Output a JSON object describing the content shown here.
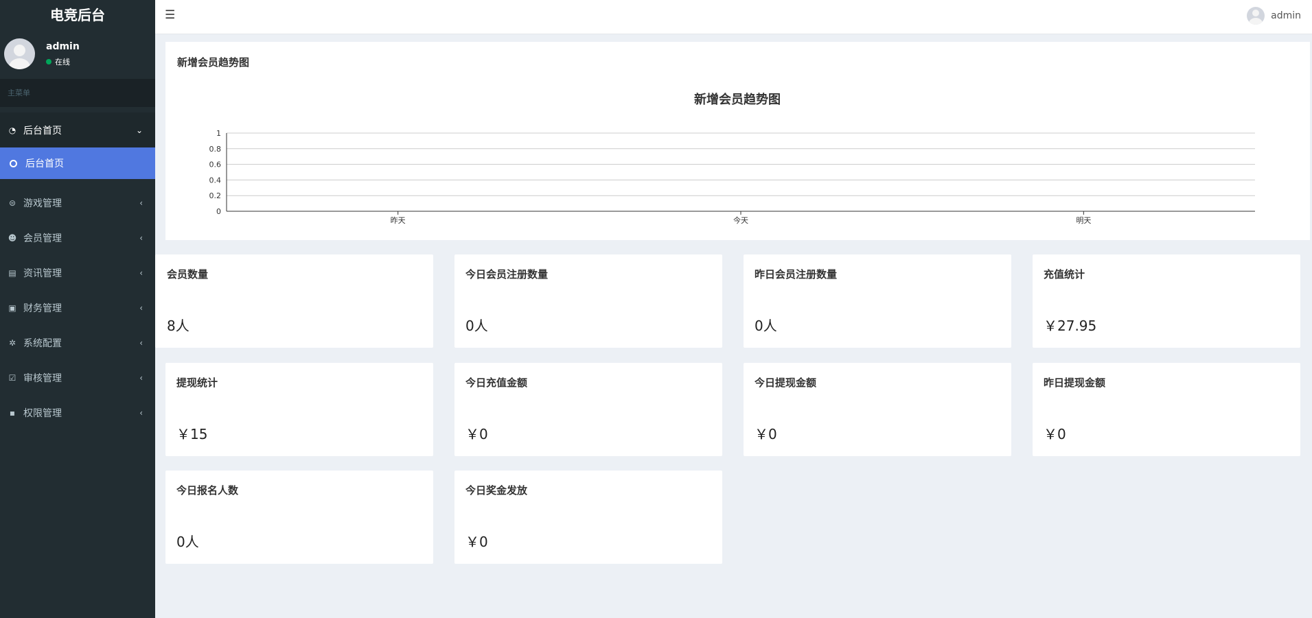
{
  "brand": "电竞后台",
  "user": {
    "name": "admin",
    "status": "在线"
  },
  "menu_header": "主菜单",
  "nav": {
    "home_parent": "后台首页",
    "home_sub": "后台首页",
    "items": [
      {
        "label": "游戏管理",
        "icon": "gamepad-icon"
      },
      {
        "label": "会员管理",
        "icon": "users-icon"
      },
      {
        "label": "资讯管理",
        "icon": "newspaper-icon"
      },
      {
        "label": "财务管理",
        "icon": "money-icon"
      },
      {
        "label": "系统配置",
        "icon": "gear-icon"
      },
      {
        "label": "审核管理",
        "icon": "check-square-icon"
      },
      {
        "label": "权限管理",
        "icon": "lock-icon"
      }
    ]
  },
  "topbar": {
    "user": "admin"
  },
  "chart_panel": {
    "title": "新增会员趋势图"
  },
  "chart_data": {
    "type": "line",
    "title": "新增会员趋势图",
    "categories": [
      "昨天",
      "今天",
      "明天"
    ],
    "yticks": [
      "0",
      "0.2",
      "0.4",
      "0.6",
      "0.8",
      "1"
    ],
    "ylim": [
      0,
      1
    ],
    "grid": true,
    "series": []
  },
  "cards": [
    {
      "title": "会员数量",
      "value": "8人"
    },
    {
      "title": "今日会员注册数量",
      "value": "0人"
    },
    {
      "title": "昨日会员注册数量",
      "value": "0人"
    },
    {
      "title": "充值统计",
      "value": "￥27.95"
    },
    {
      "title": "提现统计",
      "value": "￥15"
    },
    {
      "title": "今日充值金额",
      "value": "￥0"
    },
    {
      "title": "今日提现金额",
      "value": "￥0"
    },
    {
      "title": "昨日提现金额",
      "value": "￥0"
    },
    {
      "title": "今日报名人数",
      "value": "0人"
    },
    {
      "title": "今日奖金发放",
      "value": "￥0"
    }
  ],
  "colors": {
    "sidebar": "#222d32",
    "active": "#5078e0",
    "online": "#00a65a"
  }
}
